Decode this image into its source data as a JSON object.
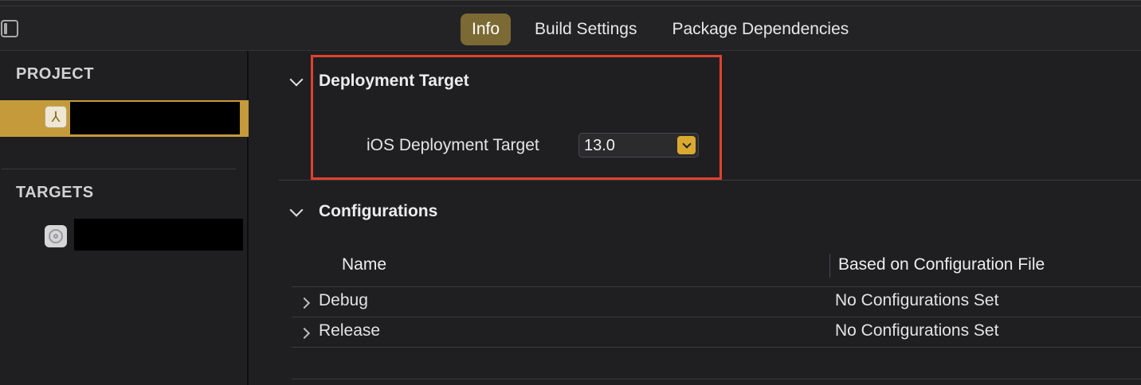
{
  "tabs": [
    {
      "label": "Info",
      "active": true
    },
    {
      "label": "Build Settings",
      "active": false
    },
    {
      "label": "Package Dependencies",
      "active": false
    }
  ],
  "sidebar": {
    "project_header": "PROJECT",
    "targets_header": "TARGETS"
  },
  "deployment": {
    "title": "Deployment Target",
    "field_label": "iOS Deployment Target",
    "value": "13.0"
  },
  "configurations": {
    "title": "Configurations",
    "columns": [
      "Name",
      "Based on Configuration File"
    ],
    "rows": [
      {
        "name": "Debug",
        "file": "No Configurations Set"
      },
      {
        "name": "Release",
        "file": "No Configurations Set"
      }
    ]
  },
  "colors": {
    "accent": "#c59a3a",
    "active_tab": "#7c6a34",
    "highlight": "#e0412d",
    "popup_button": "#d9a930"
  },
  "icons": [
    "sidebar-toggle-icon",
    "app-project-icon",
    "target-gear-icon",
    "chevron-down-icon",
    "chevron-right-icon",
    "popup-caret-icon"
  ]
}
